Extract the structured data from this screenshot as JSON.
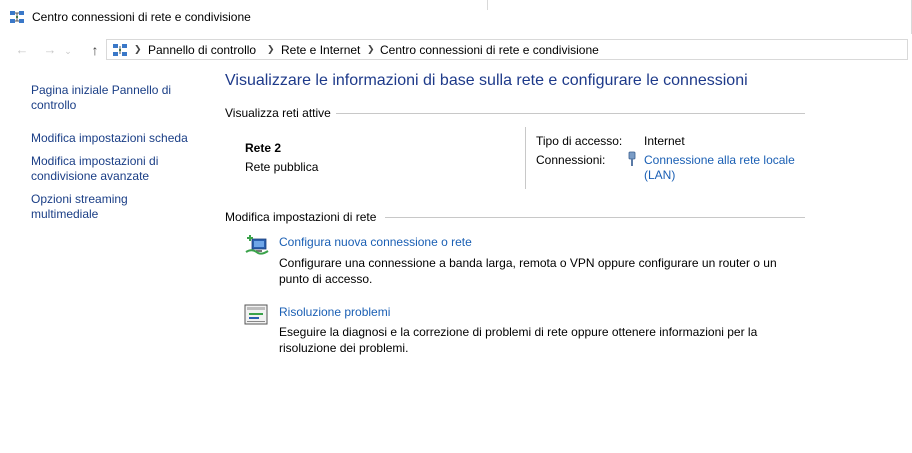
{
  "window": {
    "title": "Centro connessioni di rete e condivisione"
  },
  "nav": {
    "back_icon": "arrow-left-icon",
    "forward_icon": "arrow-right-icon",
    "up_icon": "arrow-up-icon",
    "breadcrumbs": [
      "Pannello di controllo",
      "Rete e Internet",
      "Centro connessioni di rete e condivisione"
    ]
  },
  "sidebar": {
    "items": [
      {
        "label": "Pagina iniziale Pannello di controllo"
      },
      {
        "label": "Modifica impostazioni scheda"
      },
      {
        "label": "Modifica impostazioni di condivisione avanzate"
      },
      {
        "label": "Opzioni streaming multimediale"
      }
    ]
  },
  "main": {
    "title": "Visualizzare le informazioni di base sulla rete e configurare le connessioni",
    "active_networks": {
      "heading": "Visualizza reti attive",
      "network_name": "Rete 2",
      "network_type": "Rete pubblica",
      "access_type_label": "Tipo di accesso:",
      "access_type_value": "Internet",
      "connections_label": "Connessioni:",
      "connection_link": "Connessione alla rete locale (LAN)"
    },
    "change_settings": {
      "heading": "Modifica impostazioni di rete",
      "tasks": [
        {
          "link": "Configura nuova connessione o rete",
          "description": "Configurare una connessione a banda larga, remota o VPN oppure configurare un router o un punto di accesso.",
          "icon": "new-connection-icon"
        },
        {
          "link": "Risoluzione problemi",
          "description": "Eseguire la diagnosi e la correzione di problemi di rete oppure ottenere informazioni per la risoluzione dei problemi.",
          "icon": "troubleshoot-icon"
        }
      ]
    }
  },
  "colors": {
    "link": "#1a5fb4",
    "title": "#1e3a8a",
    "sidebar_link": "#1a3e86"
  }
}
